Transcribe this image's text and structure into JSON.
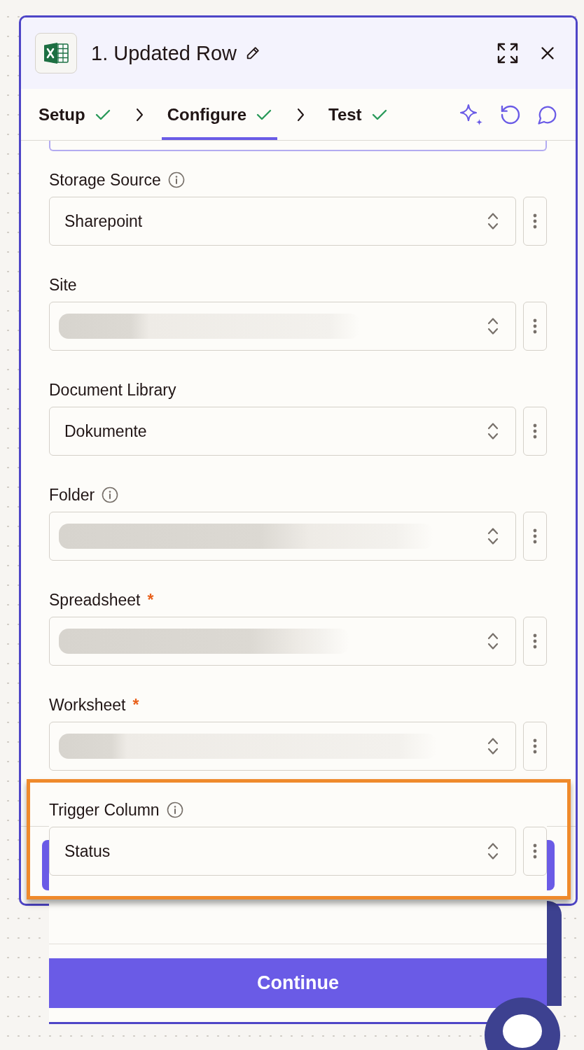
{
  "panel": {
    "title": "1. Updated Row"
  },
  "tabs": [
    {
      "label": "Setup",
      "done": true,
      "selected": false
    },
    {
      "label": "Configure",
      "done": true,
      "selected": true
    },
    {
      "label": "Test",
      "done": true,
      "selected": false
    }
  ],
  "fields": [
    {
      "label": "Storage Source",
      "info": true,
      "blurred": false,
      "value": "Sharepoint"
    },
    {
      "label": "Site",
      "info": false,
      "blurred": true
    },
    {
      "label": "Document Library",
      "info": false,
      "blurred": false,
      "value": "Dokumente"
    },
    {
      "label": "Folder",
      "info": true,
      "blurred": true
    },
    {
      "label": "Spreadsheet",
      "required_marker": "*",
      "info": false,
      "blurred": true
    },
    {
      "label": "Worksheet",
      "required_marker": "*",
      "info": false,
      "blurred": true
    }
  ],
  "overlay_card": {
    "field": {
      "label": "Trigger Column",
      "info": true,
      "blurred": false,
      "value": "Status"
    },
    "button": "Continue"
  }
}
